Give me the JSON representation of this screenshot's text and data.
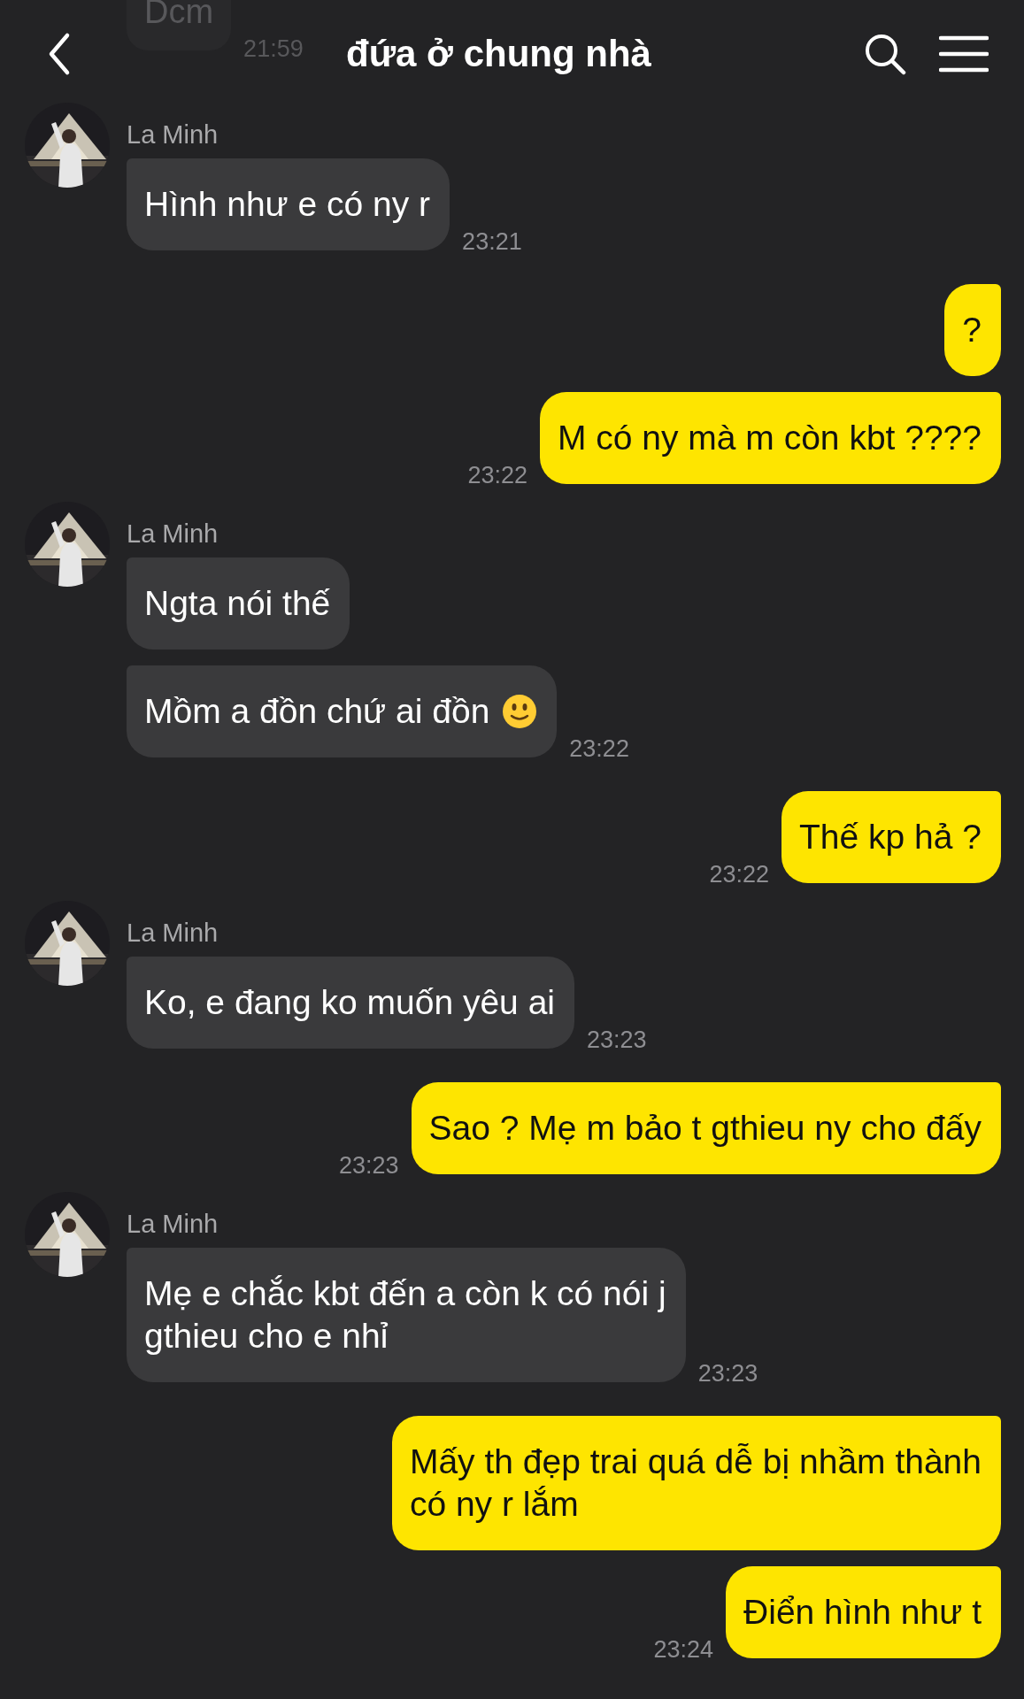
{
  "header": {
    "title": "đứa ở chung nhà",
    "behind": {
      "text": "Dcm",
      "time": "21:59"
    }
  },
  "messages": [
    {
      "kind": "received",
      "sender": "La Minh",
      "text": "Hình như e có ny r",
      "time": "23:21"
    },
    {
      "kind": "sent",
      "text": "?"
    },
    {
      "kind": "sent",
      "text": "M có ny mà m còn kbt ????",
      "time": "23:22"
    },
    {
      "kind": "received",
      "sender": "La Minh",
      "text": "Ngta nói thế"
    },
    {
      "kind": "received",
      "text": "Mồm a đồn chứ ai đồn",
      "has_emoji": true,
      "time": "23:22"
    },
    {
      "kind": "sent",
      "text": "Thế kp hả ?",
      "time": "23:22"
    },
    {
      "kind": "received",
      "sender": "La Minh",
      "text": "Ko, e đang ko muốn yêu ai",
      "time": "23:23"
    },
    {
      "kind": "sent",
      "text": "Sao ? Mẹ m bảo t gthieu ny cho đấy",
      "time": "23:23"
    },
    {
      "kind": "received",
      "sender": "La Minh",
      "text": "Mẹ e chắc kbt đến a còn k có nói j\ngthieu cho e nhỉ",
      "time": "23:23"
    },
    {
      "kind": "sent",
      "text": "Mấy th đẹp trai quá dễ bị nhầm thành\ncó ny r lắm"
    },
    {
      "kind": "sent",
      "text": "Điển hình như t",
      "time": "23:24"
    }
  ]
}
